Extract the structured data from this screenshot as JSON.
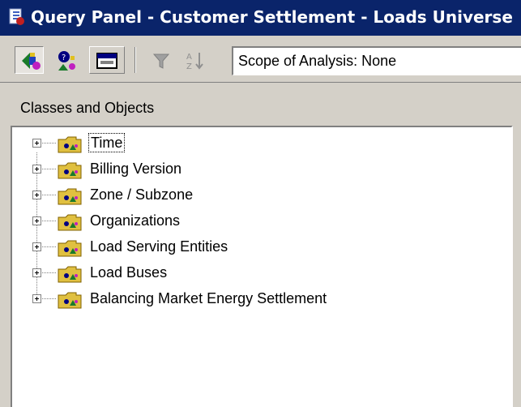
{
  "window": {
    "title": "Query Panel - Customer Settlement - Loads Universe",
    "accent": "#0a246a"
  },
  "toolbar": {
    "buttons": [
      {
        "name": "classes-objects-icon",
        "pressed": true
      },
      {
        "name": "user-objects-icon",
        "pressed": false
      },
      {
        "name": "properties-icon",
        "pressed": false
      },
      {
        "name": "filter-icon",
        "disabled": true
      },
      {
        "name": "sort-icon",
        "disabled": true
      }
    ],
    "scope_label": "Scope of Analysis: None"
  },
  "panel": {
    "label": "Classes and Objects"
  },
  "tree": {
    "items": [
      {
        "label": "Time",
        "focused": true
      },
      {
        "label": "Billing Version"
      },
      {
        "label": "Zone / Subzone"
      },
      {
        "label": "Organizations"
      },
      {
        "label": "Load Serving Entities"
      },
      {
        "label": "Load Buses"
      },
      {
        "label": "Balancing Market Energy Settlement"
      }
    ]
  }
}
